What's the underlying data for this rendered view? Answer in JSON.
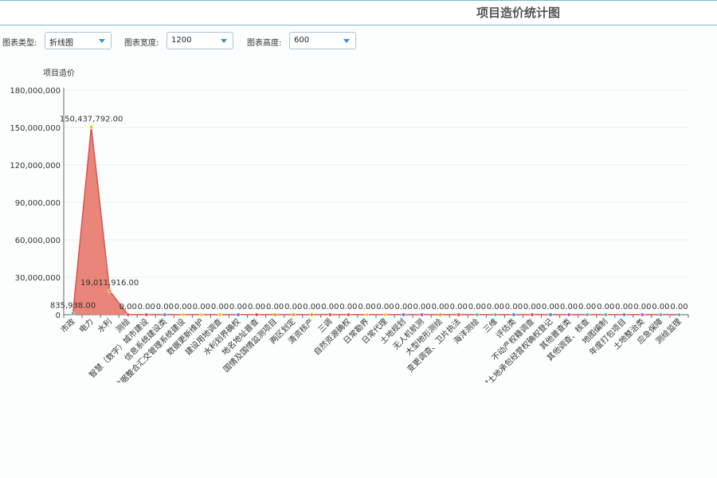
{
  "page": {
    "title": "项目造价统计图"
  },
  "controls": {
    "type": {
      "label": "图表类型:",
      "value": "折线图"
    },
    "width": {
      "label": "图表宽度:",
      "value": "1200"
    },
    "height": {
      "label": "图表高度:",
      "value": "600"
    }
  },
  "chart_data": {
    "type": "area",
    "title": "",
    "ylabel": "项目造价",
    "xlabel": "",
    "ylim": [
      0,
      180000000
    ],
    "yticks": [
      0,
      30000000,
      60000000,
      90000000,
      120000000,
      150000000,
      180000000
    ],
    "ytick_labels": [
      "0",
      "30,000,000",
      "60,000,000",
      "90,000,000",
      "120,000,000",
      "150,000,000",
      "180,000,000"
    ],
    "grid": true,
    "fill_color": "#e8786a",
    "line_color": "#d9534f",
    "categories": [
      "市政",
      "电力",
      "水利",
      "测绘",
      "智慧（数字）城市建设",
      "信息系统建设类",
      "承包权数据整合汇交管理系统建设",
      "数据更新维护",
      "建设用地调查",
      "水利划界确权",
      "地名地址普查",
      "国情及国情监测项目",
      "两区划定",
      "清资核产",
      "三调",
      "自然资源确权",
      "日常勘界",
      "日常代理",
      "土地规划",
      "无人机航测",
      "大型地形测绘",
      "变更调查、卫片执法",
      "海洋测绘",
      "三维",
      "评估类",
      "不动产权籍调查",
      "农村土地承包经营权确权登记",
      "其他普查类",
      "其他调查、核查",
      "地图编制",
      "年度打包项目",
      "土地整治类",
      "应急保障",
      "测绘监理"
    ],
    "values": [
      835938,
      150437792,
      19011916,
      0,
      0,
      0,
      0,
      0,
      0,
      0,
      0,
      0,
      0,
      0,
      0,
      0,
      0,
      0,
      0,
      0,
      0,
      0,
      0,
      0,
      0,
      0,
      0,
      0,
      0,
      0,
      0,
      0,
      0,
      0
    ],
    "value_labels": [
      "835,938.00",
      "150,437,792.00",
      "19,011,916.00",
      "0.00",
      "0.00",
      "0.00",
      "0.00",
      "0.00",
      "0.00",
      "0.00",
      "0.00",
      "0.00",
      "0.00",
      "0.00",
      "0.00",
      "0.00",
      "0.00",
      "0.00",
      "0.00",
      "0.00",
      "0.00",
      "0.00",
      "0.00",
      "0.00",
      "0.00",
      "0.00",
      "0.00",
      "0.00",
      "0.00",
      "0.00",
      "0.00",
      "0.00",
      "0.00",
      "0.00"
    ],
    "point_colors": [
      "#4db6ac",
      "#f0c419",
      "#ff8c00",
      "#e74c3c",
      "#e74c3c",
      "#3b8cc4",
      "#f0c419",
      "#f0c419",
      "#f0c419",
      "#3b8cc4",
      "#e74c3c",
      "#ff8c00",
      "#ff8c00",
      "#ff8c00",
      "#e74c3c",
      "#e74c3c",
      "#f0c419",
      "#f0c419",
      "#3b8cc4",
      "#b44fd6",
      "#ff8c00",
      "#e74c3c",
      "#4db6ac",
      "#4db6ac",
      "#3b8cc4",
      "#e74c3c",
      "#3b8cc4",
      "#b44fd6",
      "#4db6ac",
      "#4db6ac",
      "#3b8cc4",
      "#b44fd6",
      "#4db6ac",
      "#4db6ac"
    ]
  }
}
